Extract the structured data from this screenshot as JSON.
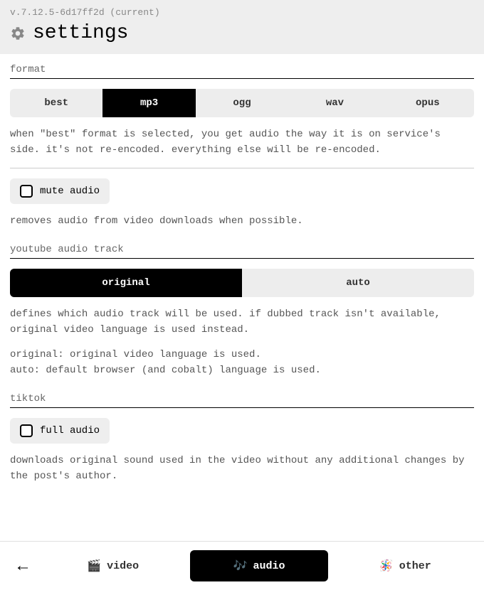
{
  "header": {
    "version": "v.7.12.5-6d17ff2d (current)",
    "title": "settings"
  },
  "sections": {
    "format": {
      "label": "format",
      "options": [
        "best",
        "mp3",
        "ogg",
        "wav",
        "opus"
      ],
      "selected": "mp3",
      "description": "when \"best\" format is selected, you get audio the way it is on service's side. it's not re-encoded. everything else will be re-encoded."
    },
    "mute": {
      "label": "mute audio",
      "checked": false,
      "description": "removes audio from video downloads when possible."
    },
    "youtube_track": {
      "label": "youtube audio track",
      "options": [
        "original",
        "auto"
      ],
      "selected": "original",
      "description": "defines which audio track will be used. if dubbed track isn't available, original video language is used instead.",
      "explain": "original: original video language is used.\nauto: default browser (and cobalt) language is used."
    },
    "tiktok": {
      "label": "tiktok",
      "full_audio_label": "full audio",
      "full_audio_checked": false,
      "description": "downloads original sound used in the video without any additional changes by the post's author."
    }
  },
  "footer": {
    "tabs": {
      "video": "video",
      "audio": "audio",
      "other": "other"
    },
    "active": "audio"
  }
}
